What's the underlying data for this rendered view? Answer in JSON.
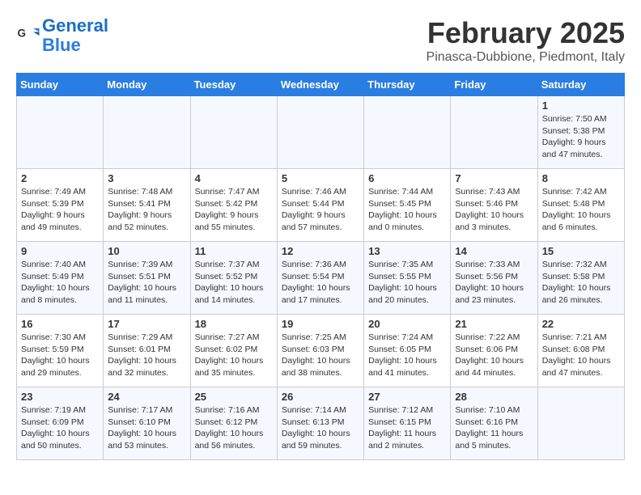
{
  "header": {
    "logo_line1": "General",
    "logo_line2": "Blue",
    "title": "February 2025",
    "subtitle": "Pinasca-Dubbione, Piedmont, Italy"
  },
  "columns": [
    "Sunday",
    "Monday",
    "Tuesday",
    "Wednesday",
    "Thursday",
    "Friday",
    "Saturday"
  ],
  "weeks": [
    {
      "days": [
        {
          "num": "",
          "info": ""
        },
        {
          "num": "",
          "info": ""
        },
        {
          "num": "",
          "info": ""
        },
        {
          "num": "",
          "info": ""
        },
        {
          "num": "",
          "info": ""
        },
        {
          "num": "",
          "info": ""
        },
        {
          "num": "1",
          "info": "Sunrise: 7:50 AM\nSunset: 5:38 PM\nDaylight: 9 hours and 47 minutes."
        }
      ]
    },
    {
      "days": [
        {
          "num": "2",
          "info": "Sunrise: 7:49 AM\nSunset: 5:39 PM\nDaylight: 9 hours and 49 minutes."
        },
        {
          "num": "3",
          "info": "Sunrise: 7:48 AM\nSunset: 5:41 PM\nDaylight: 9 hours and 52 minutes."
        },
        {
          "num": "4",
          "info": "Sunrise: 7:47 AM\nSunset: 5:42 PM\nDaylight: 9 hours and 55 minutes."
        },
        {
          "num": "5",
          "info": "Sunrise: 7:46 AM\nSunset: 5:44 PM\nDaylight: 9 hours and 57 minutes."
        },
        {
          "num": "6",
          "info": "Sunrise: 7:44 AM\nSunset: 5:45 PM\nDaylight: 10 hours and 0 minutes."
        },
        {
          "num": "7",
          "info": "Sunrise: 7:43 AM\nSunset: 5:46 PM\nDaylight: 10 hours and 3 minutes."
        },
        {
          "num": "8",
          "info": "Sunrise: 7:42 AM\nSunset: 5:48 PM\nDaylight: 10 hours and 6 minutes."
        }
      ]
    },
    {
      "days": [
        {
          "num": "9",
          "info": "Sunrise: 7:40 AM\nSunset: 5:49 PM\nDaylight: 10 hours and 8 minutes."
        },
        {
          "num": "10",
          "info": "Sunrise: 7:39 AM\nSunset: 5:51 PM\nDaylight: 10 hours and 11 minutes."
        },
        {
          "num": "11",
          "info": "Sunrise: 7:37 AM\nSunset: 5:52 PM\nDaylight: 10 hours and 14 minutes."
        },
        {
          "num": "12",
          "info": "Sunrise: 7:36 AM\nSunset: 5:54 PM\nDaylight: 10 hours and 17 minutes."
        },
        {
          "num": "13",
          "info": "Sunrise: 7:35 AM\nSunset: 5:55 PM\nDaylight: 10 hours and 20 minutes."
        },
        {
          "num": "14",
          "info": "Sunrise: 7:33 AM\nSunset: 5:56 PM\nDaylight: 10 hours and 23 minutes."
        },
        {
          "num": "15",
          "info": "Sunrise: 7:32 AM\nSunset: 5:58 PM\nDaylight: 10 hours and 26 minutes."
        }
      ]
    },
    {
      "days": [
        {
          "num": "16",
          "info": "Sunrise: 7:30 AM\nSunset: 5:59 PM\nDaylight: 10 hours and 29 minutes."
        },
        {
          "num": "17",
          "info": "Sunrise: 7:29 AM\nSunset: 6:01 PM\nDaylight: 10 hours and 32 minutes."
        },
        {
          "num": "18",
          "info": "Sunrise: 7:27 AM\nSunset: 6:02 PM\nDaylight: 10 hours and 35 minutes."
        },
        {
          "num": "19",
          "info": "Sunrise: 7:25 AM\nSunset: 6:03 PM\nDaylight: 10 hours and 38 minutes."
        },
        {
          "num": "20",
          "info": "Sunrise: 7:24 AM\nSunset: 6:05 PM\nDaylight: 10 hours and 41 minutes."
        },
        {
          "num": "21",
          "info": "Sunrise: 7:22 AM\nSunset: 6:06 PM\nDaylight: 10 hours and 44 minutes."
        },
        {
          "num": "22",
          "info": "Sunrise: 7:21 AM\nSunset: 6:08 PM\nDaylight: 10 hours and 47 minutes."
        }
      ]
    },
    {
      "days": [
        {
          "num": "23",
          "info": "Sunrise: 7:19 AM\nSunset: 6:09 PM\nDaylight: 10 hours and 50 minutes."
        },
        {
          "num": "24",
          "info": "Sunrise: 7:17 AM\nSunset: 6:10 PM\nDaylight: 10 hours and 53 minutes."
        },
        {
          "num": "25",
          "info": "Sunrise: 7:16 AM\nSunset: 6:12 PM\nDaylight: 10 hours and 56 minutes."
        },
        {
          "num": "26",
          "info": "Sunrise: 7:14 AM\nSunset: 6:13 PM\nDaylight: 10 hours and 59 minutes."
        },
        {
          "num": "27",
          "info": "Sunrise: 7:12 AM\nSunset: 6:15 PM\nDaylight: 11 hours and 2 minutes."
        },
        {
          "num": "28",
          "info": "Sunrise: 7:10 AM\nSunset: 6:16 PM\nDaylight: 11 hours and 5 minutes."
        },
        {
          "num": "",
          "info": ""
        }
      ]
    }
  ]
}
